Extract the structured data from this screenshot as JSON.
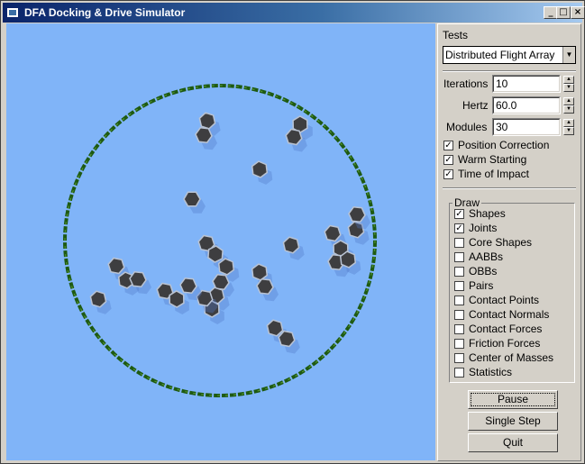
{
  "window": {
    "title": "DFA Docking & Drive Simulator"
  },
  "titlebar": {
    "minimize_icon": "_",
    "maximize_icon": "□",
    "close_icon": "×"
  },
  "panel": {
    "tests_label": "Tests",
    "test_selected": "Distributed Flight Array",
    "iterations_label": "Iterations",
    "iterations_value": "10",
    "hertz_label": "Hertz",
    "hertz_value": "60.0",
    "modules_label": "Modules",
    "modules_value": "30",
    "options": [
      {
        "label": "Position Correction",
        "checked": true
      },
      {
        "label": "Warm Starting",
        "checked": true
      },
      {
        "label": "Time of Impact",
        "checked": true
      }
    ],
    "draw": {
      "title": "Draw",
      "items": [
        {
          "label": "Shapes",
          "checked": true
        },
        {
          "label": "Joints",
          "checked": true
        },
        {
          "label": "Core Shapes",
          "checked": false
        },
        {
          "label": "AABBs",
          "checked": false
        },
        {
          "label": "OBBs",
          "checked": false
        },
        {
          "label": "Pairs",
          "checked": false
        },
        {
          "label": "Contact Points",
          "checked": false
        },
        {
          "label": "Contact Normals",
          "checked": false
        },
        {
          "label": "Contact Forces",
          "checked": false
        },
        {
          "label": "Friction Forces",
          "checked": false
        },
        {
          "label": "Center of Masses",
          "checked": false
        },
        {
          "label": "Statistics",
          "checked": false
        }
      ]
    },
    "buttons": {
      "pause": "Pause",
      "single_step": "Single Step",
      "quit": "Quit"
    }
  },
  "colors": {
    "viewport_bg": "#80b4f8",
    "arena_ring": "#1e5a12",
    "module_fill": "#3e3e40",
    "module_edge": "#b9c3d3",
    "module_shadow": "#5078c8"
  }
}
